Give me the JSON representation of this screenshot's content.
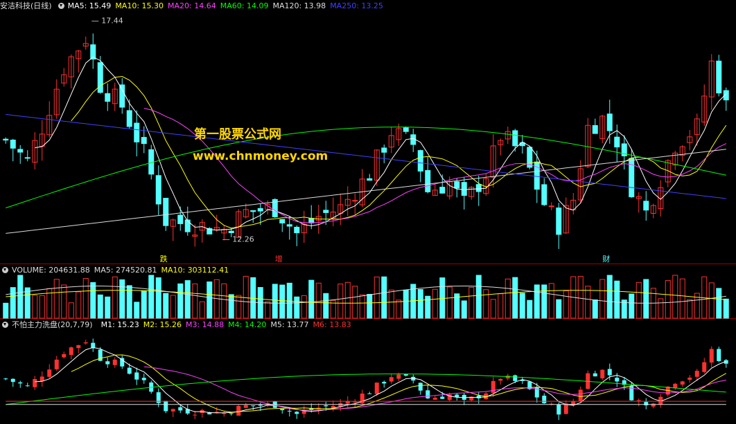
{
  "main": {
    "title": "安洁科技(日线)",
    "ma_labels": [
      {
        "text": "MA5: 15.49",
        "color": "#ffffff"
      },
      {
        "text": "MA10: 15.30",
        "color": "#ffff00"
      },
      {
        "text": "MA20: 14.64",
        "color": "#ff40ff"
      },
      {
        "text": "MA60: 14.09",
        "color": "#00ff00"
      },
      {
        "text": "MA120: 13.98",
        "color": "#dddddd"
      },
      {
        "text": "MA250: 13.25",
        "color": "#4040ff"
      }
    ],
    "high_label": "17.44",
    "low_label": "12.26",
    "markers": [
      "跌",
      "增",
      "财"
    ],
    "watermark_cn": "第一股票公式网",
    "watermark_url": "www.chnmoney.com"
  },
  "volume": {
    "label": "VOLUME: 204631.88",
    "ma5": "MA5: 274520.81",
    "ma10": "MA10: 303112.41"
  },
  "indicator": {
    "title": "不怕主力洗盘(20,7,79)",
    "labels": [
      {
        "text": "M1: 15.23",
        "color": "#ffffff"
      },
      {
        "text": "M2: 15.26",
        "color": "#ffff00"
      },
      {
        "text": "M3: 14.88",
        "color": "#ff40ff"
      },
      {
        "text": "M4: 14.20",
        "color": "#00ff00"
      },
      {
        "text": "M5: 13.77",
        "color": "#dddddd"
      },
      {
        "text": "M6: 13.83",
        "color": "#ff3030"
      }
    ]
  },
  "colors": {
    "up": "#ff3030",
    "down": "#54ffff",
    "grid": "#a00000"
  }
}
